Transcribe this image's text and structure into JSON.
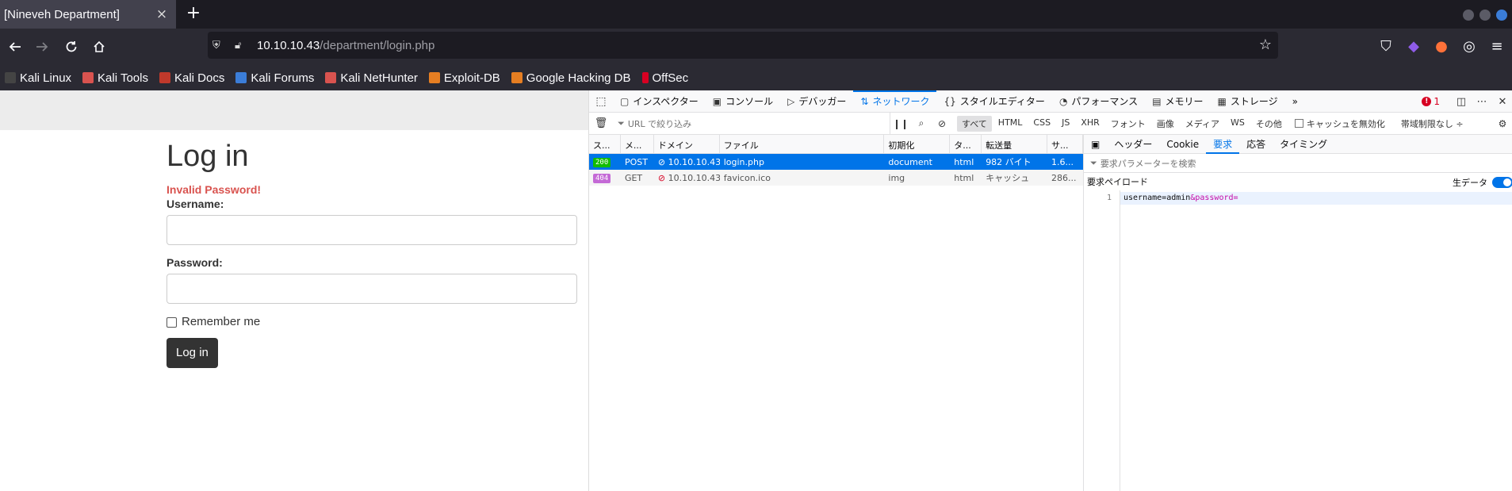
{
  "browser": {
    "tab_title": "[Nineveh Department]",
    "tab_close": "×",
    "new_tab": "+",
    "url_host": "10.10.10.43",
    "url_path": "/department/login.php",
    "bookmarks": [
      {
        "label": "Kali Linux",
        "color": "#2b2a33"
      },
      {
        "label": "Kali Tools",
        "color": "#d9534f"
      },
      {
        "label": "Kali Docs",
        "color": "#c0392b"
      },
      {
        "label": "Kali Forums",
        "color": "#3b7dd8"
      },
      {
        "label": "Kali NetHunter",
        "color": "#d9534f"
      },
      {
        "label": "Exploit-DB",
        "color": "#e67e22"
      },
      {
        "label": "Google Hacking DB",
        "color": "#e67e22"
      },
      {
        "label": "OffSec",
        "color": "#d70022"
      }
    ]
  },
  "page": {
    "heading": "Log in",
    "error": "Invalid Password!",
    "username_label": "Username:",
    "password_label": "Password:",
    "remember_label": "Remember me",
    "submit_label": "Log in"
  },
  "devtools": {
    "tabs": [
      {
        "label": "インスペクター",
        "icon": "inspector-icon",
        "glyph": "▢"
      },
      {
        "label": "コンソール",
        "icon": "console-icon",
        "glyph": "▣"
      },
      {
        "label": "デバッガー",
        "icon": "debugger-icon",
        "glyph": "▷"
      },
      {
        "label": "ネットワーク",
        "icon": "network-icon",
        "glyph": "⇅",
        "active": true
      },
      {
        "label": "スタイルエディター",
        "icon": "style-editor-icon",
        "glyph": "{}"
      },
      {
        "label": "パフォーマンス",
        "icon": "performance-icon",
        "glyph": "◔"
      },
      {
        "label": "メモリー",
        "icon": "memory-icon",
        "glyph": "▤"
      },
      {
        "label": "ストレージ",
        "icon": "storage-icon",
        "glyph": "▦"
      }
    ],
    "more_tabs": "»",
    "error_count": "1",
    "filter_placeholder": "URL で絞り込み",
    "filter_types": [
      "すべて",
      "HTML",
      "CSS",
      "JS",
      "XHR",
      "フォント",
      "画像",
      "メディア",
      "WS",
      "その他"
    ],
    "disable_cache": "キャッシュを無効化",
    "throttle": "帯域制限なし ÷",
    "columns": [
      "ス...",
      "メ...",
      "ドメイン",
      "ファイル",
      "初期化",
      "タ...",
      "転送量",
      "サ..."
    ],
    "requests": [
      {
        "status": "200",
        "status_color": "#12bc00",
        "method": "POST",
        "domain": "10.10.10.43",
        "file": "login.php",
        "initiator": "document",
        "type": "html",
        "transferred": "982 バイト",
        "size": "1.6..."
      },
      {
        "status": "404",
        "status_color": "#c46ad6",
        "method": "GET",
        "domain": "10.10.10.43",
        "file": "favicon.ico",
        "initiator": "img",
        "type": "html",
        "transferred": "キャッシュ",
        "size": "286..."
      }
    ],
    "detail_tabs": [
      "ヘッダー",
      "Cookie",
      "要求",
      "応答",
      "タイミング"
    ],
    "detail_active": "要求",
    "param_filter_placeholder": "要求パラメーターを検索",
    "payload_title": "要求ペイロード",
    "raw_label": "生データ",
    "payload": {
      "line_number": "1",
      "name1": "username",
      "eq1": "=",
      "val1": "admin",
      "amp": "&",
      "name2": "password",
      "eq2": "="
    }
  }
}
